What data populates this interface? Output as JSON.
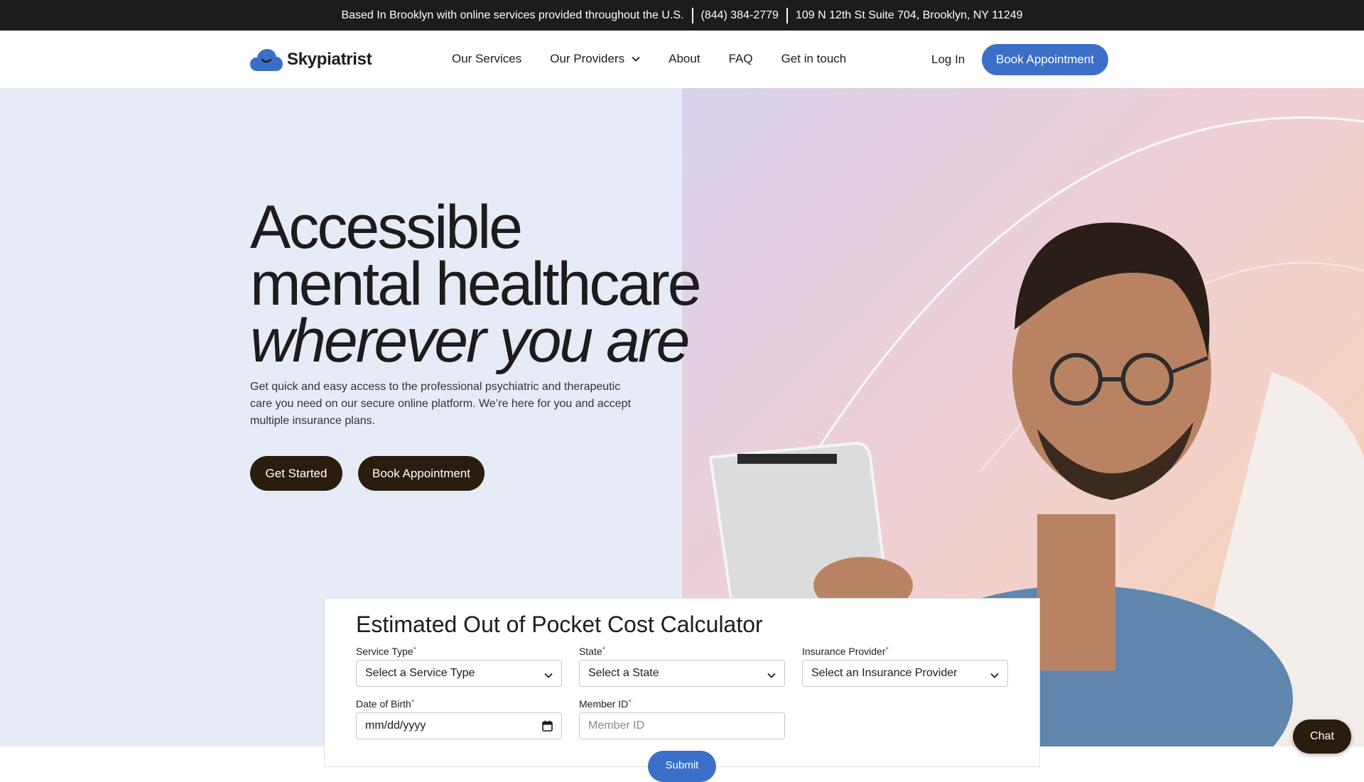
{
  "topbar": {
    "location": "Based In Brooklyn with online services provided throughout the U.S.",
    "phone": "(844) 384-2779",
    "address": "109 N 12th St Suite 704, Brooklyn, NY 11249"
  },
  "nav": {
    "logo_text": "Skypiatrist",
    "links": [
      "Our Services",
      "Our Providers",
      "About",
      "FAQ",
      "Get in touch"
    ],
    "login": "Log In",
    "book": "Book Appointment"
  },
  "hero": {
    "line1": "Accessible",
    "line2": "mental healthcare",
    "line3": "wherever you are",
    "subtext": "Get quick and easy access to the professional psychiatric and therapeutic care you need on our secure online platform. We’re here for you and accept multiple insurance plans.",
    "get_started": "Get Started",
    "book": "Book Appointment"
  },
  "calculator": {
    "title": "Estimated Out of Pocket Cost Calculator",
    "required_mark": "*",
    "service_type": {
      "label": "Service Type",
      "value": "Select a Service Type"
    },
    "state": {
      "label": "State",
      "value": "Select a State"
    },
    "insurance": {
      "label": "Insurance Provider",
      "value": "Select an Insurance Provider"
    },
    "dob": {
      "label": "Date of Birth",
      "value": "mm/dd/yyyy"
    },
    "member_id": {
      "label": "Member ID",
      "placeholder": "Member ID"
    },
    "submit": "Submit"
  },
  "chat": {
    "label": "Chat"
  },
  "colors": {
    "brand_blue": "#3b6fc7",
    "dark_brown": "#2b1d0e",
    "hero_bg": "#e7ebf8",
    "topbar_bg": "#1c1c1c",
    "required_red": "#d0342c"
  },
  "icons": [
    "cloud-logo-icon",
    "chevron-down-icon",
    "calendar-icon"
  ]
}
